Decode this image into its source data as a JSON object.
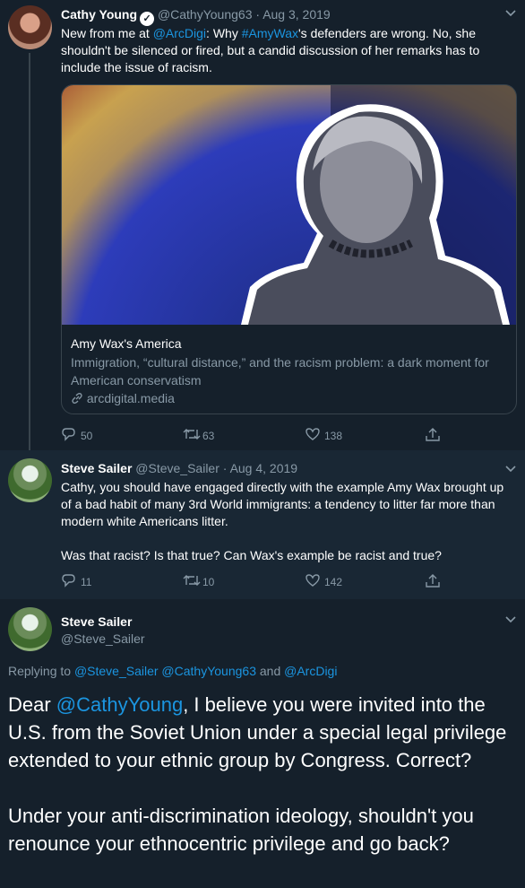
{
  "tweet1": {
    "author_name": "Cathy Young",
    "handle": "@CathyYoung63",
    "separator": "·",
    "date": "Aug 3, 2019",
    "text_intro": "New from me at ",
    "mention": "@ArcDigi",
    "text_mid": ": Why ",
    "hashtag": "#AmyWax",
    "text_rest": "'s defenders are wrong. No, she shouldn't be silenced or fired, but a candid discussion of her remarks has to include the issue of racism.",
    "card": {
      "title": "Amy Wax's America",
      "description": "Immigration, “cultural distance,” and the racism problem: a dark moment for American conservatism",
      "domain": "arcdigital.media"
    },
    "replies": "50",
    "retweets": "63",
    "likes": "138"
  },
  "tweet2": {
    "author_name": "Steve Sailer",
    "handle": "@Steve_Sailer",
    "separator": "·",
    "date": "Aug 4, 2019",
    "text_p1": "Cathy, you should have engaged directly with the example Amy Wax brought up of a bad habit of many 3rd World immigrants: a tendency to litter far more than modern white Americans litter.",
    "text_p2": "Was that racist? Is that true? Can Wax's example be racist and true?",
    "replies": "11",
    "retweets": "10",
    "likes": "142"
  },
  "tweet3": {
    "author_name": "Steve Sailer",
    "handle": "@Steve_Sailer",
    "replying_label": "Replying to ",
    "replying_1": "@Steve_Sailer",
    "replying_2": "@CathyYoung63",
    "replying_and": " and ",
    "replying_3": "@ArcDigi",
    "text_dear": "Dear ",
    "text_mention": "@CathyYoung",
    "text_p1_rest": ", I believe you were invited into the U.S. from the Soviet Union under a special legal privilege extended to your ethnic group by Congress. Correct?",
    "text_p2": "Under your anti-discrimination ideology, shouldn't you renounce your ethnocentric privilege and go back?"
  },
  "icons": {
    "chevron": "chevron-down-icon",
    "verified": "verified-badge-icon",
    "reply": "reply-icon",
    "retweet": "retweet-icon",
    "like": "heart-icon",
    "share": "share-icon",
    "link": "link-icon"
  },
  "colors": {
    "background": "#15202b",
    "reply_background": "#192734",
    "accent": "#1b95e0",
    "muted": "#8899a6",
    "border": "#38444d"
  }
}
